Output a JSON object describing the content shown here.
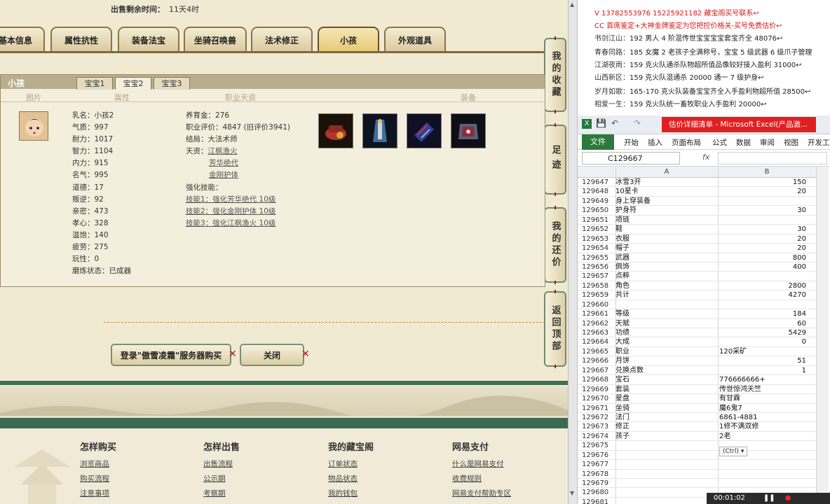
{
  "sale": {
    "label": "出售剩余时间：",
    "value": "11天4时"
  },
  "main_tabs": [
    {
      "label": "基本信息"
    },
    {
      "label": "属性抗性"
    },
    {
      "label": "装备法宝"
    },
    {
      "label": "坐骑召唤兽"
    },
    {
      "label": "法术修正"
    },
    {
      "label": "小孩"
    },
    {
      "label": "外观道具"
    }
  ],
  "sidebar": [
    {
      "label": "我的收藏"
    },
    {
      "label": "足迹"
    },
    {
      "label": "我的还价"
    },
    {
      "label": "返回顶部"
    }
  ],
  "panel": {
    "title": "小孩",
    "subtabs": [
      {
        "label": "宝宝1"
      },
      {
        "label": "宝宝2"
      },
      {
        "label": "宝宝3"
      }
    ],
    "col_heads": {
      "image": "图片",
      "attrs": "属性",
      "job": "职业天资",
      "equip": "装备"
    },
    "attrs": [
      "乳名：小孩2",
      "气质：997",
      "耐力：1017",
      "智力：1104",
      "内力：915",
      "名气：995",
      "道德：17",
      "叛逆：92",
      "亲密：473",
      "孝心：328",
      "温饱：140",
      "疲劳：275",
      "玩性：0",
      "磨炼状态：已成器"
    ],
    "job": {
      "money": "养育金：276",
      "eval": "职业评价：4847 (旧评价3941)",
      "ending": "结局：大法术师",
      "talent_label": "天资：",
      "talents": [
        "江枫渔火",
        "芳华绝代",
        "金刚护体"
      ],
      "skill_label": "强化技能：",
      "skills": [
        "技能1：强化芳华绝代 10级",
        "技能2：强化金刚护体 10级",
        "技能3：强化江枫渔火 10级"
      ]
    },
    "equip_icons": [
      "equip-icon-1",
      "equip-icon-2",
      "equip-icon-3",
      "equip-icon-4"
    ]
  },
  "buttons": {
    "login_buy": "登录\"傲雪凌霜\"服务器购买",
    "close": "关闭",
    "x": "✕"
  },
  "footer": [
    {
      "title": "",
      "links": [
        "",
        "?"
      ]
    },
    {
      "title": "怎样购买",
      "links": [
        "浏览商品",
        "购买流程",
        "注意事项"
      ]
    },
    {
      "title": "怎样出售",
      "links": [
        "出售流程",
        "公示期",
        "考察期"
      ]
    },
    {
      "title": "我的藏宝阁",
      "links": [
        "订单状态",
        "物品状态",
        "我的钱包"
      ]
    },
    {
      "title": "网易支付",
      "links": [
        "什么是网易支付",
        "收费规则",
        "网易支付帮助专区"
      ]
    }
  ],
  "chat": [
    {
      "text": "V 13782553976    15225921182   藏宝阁买号联系↩",
      "red": true
    },
    {
      "text": "CC 首席鉴定+大神金牌鉴定为您把控价格关-买号免费估价↩",
      "red": true
    },
    {
      "name": "书剑江山：",
      "text": "192 男人 4 阶混传世宝宝宝宝套宝齐全 48076↩"
    },
    {
      "name": "青春同路：",
      "text": "185 女魔 2 老孩子全满称号，宝宝 5 级武器 6 级爪子管理"
    },
    {
      "name": "江湖夜雨：",
      "text": "159 克火队通杀队物超所值品像较好接入盈利 31000↩"
    },
    {
      "name": "山西新区：",
      "text": "159 克火队混通杀 20000 通一 7 级护身↩"
    },
    {
      "name": "岁月如歌：",
      "text": "165-170 克火队装备宝宝齐全入手盈利物超所值 28500↩"
    },
    {
      "name": "相爱一生：",
      "text": "159 克火队统一畜牧职业入手盈利 20000↩"
    }
  ],
  "excel": {
    "title": "估价详细清单 - Microsoft Excel(产品激...",
    "file_tab": "文件",
    "ribbon": [
      "开始",
      "插入",
      "页面布局",
      "公式",
      "数据",
      "审阅",
      "视图",
      "开发工"
    ],
    "namebox": "C129667",
    "fx": "fx",
    "col_a": "A",
    "col_b": "B",
    "ctrl": "(Ctrl) ▾",
    "timer": "00:01:02",
    "rows": [
      [
        "129647",
        "冰雪3开",
        "150"
      ],
      [
        "129648",
        "10星卡",
        "20"
      ],
      [
        "129649",
        "身上穿装备",
        ""
      ],
      [
        "129650",
        "护身符",
        "30"
      ],
      [
        "129651",
        "项链",
        ""
      ],
      [
        "129652",
        "鞋",
        "30"
      ],
      [
        "129653",
        "衣服",
        "20"
      ],
      [
        "129654",
        "帽子",
        "20"
      ],
      [
        "129655",
        "武器",
        "800"
      ],
      [
        "129656",
        "佩饰",
        "400"
      ],
      [
        "129657",
        "点粹",
        ""
      ],
      [
        "129658",
        "角色",
        "2800"
      ],
      [
        "129659",
        "共计",
        "4270"
      ],
      [
        "129660",
        "",
        ""
      ],
      [
        "129661",
        "等级",
        "184"
      ],
      [
        "129662",
        "天赋",
        "60"
      ],
      [
        "129663",
        "功绩",
        "5429"
      ],
      [
        "129664",
        "大成",
        "0"
      ],
      [
        "129665",
        "职业",
        "120采矿"
      ],
      [
        "129666",
        "月饼",
        "51"
      ],
      [
        "129667",
        "兑换点数",
        "1"
      ],
      [
        "129668",
        "宝石",
        "776666666+"
      ],
      [
        "129669",
        "套装",
        "传世惊鸿天竺"
      ],
      [
        "129670",
        "星盘",
        "有甘霖"
      ],
      [
        "129671",
        "坐骑",
        "魔6鬼7"
      ],
      [
        "129672",
        "法门",
        "6861-4881"
      ],
      [
        "129673",
        "修正",
        "1修不满双修"
      ],
      [
        "129674",
        "孩子",
        "2老"
      ],
      [
        "129675",
        "",
        ""
      ],
      [
        "129676",
        "",
        ""
      ],
      [
        "129677",
        "",
        ""
      ],
      [
        "129678",
        "",
        ""
      ],
      [
        "129679",
        "",
        ""
      ],
      [
        "129680",
        "",
        ""
      ],
      [
        "129681",
        "",
        ""
      ]
    ]
  }
}
